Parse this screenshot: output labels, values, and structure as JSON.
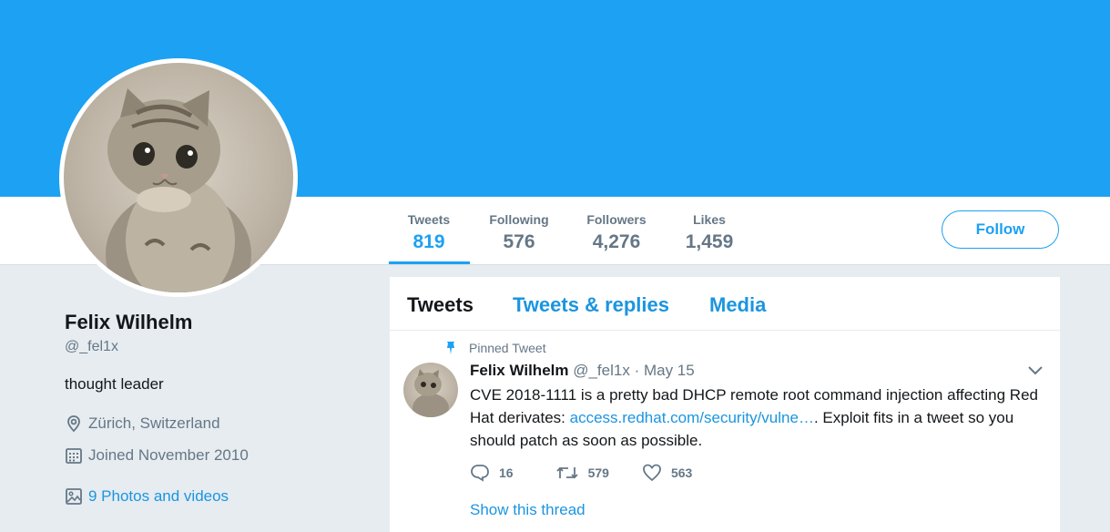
{
  "colors": {
    "banner": "#1da1f2",
    "accent": "#1da1f2",
    "link": "#1b95e0",
    "muted": "#657786"
  },
  "stats": [
    {
      "label": "Tweets",
      "value": "819"
    },
    {
      "label": "Following",
      "value": "576"
    },
    {
      "label": "Followers",
      "value": "4,276"
    },
    {
      "label": "Likes",
      "value": "1,459"
    }
  ],
  "follow_button": "Follow",
  "profile": {
    "name": "Felix Wilhelm",
    "handle": "@_fel1x",
    "bio": "thought leader",
    "location": "Zürich, Switzerland",
    "joined": "Joined November 2010",
    "photos": "9 Photos and videos"
  },
  "tabs": [
    "Tweets",
    "Tweets & replies",
    "Media"
  ],
  "tweet": {
    "pinned_label": "Pinned Tweet",
    "author": "Felix Wilhelm",
    "meta": "@_fel1x · May 15",
    "text_before": "CVE 2018-1111 is a pretty bad DHCP remote root command injection affecting Red Hat derivates: ",
    "link": "access.redhat.com/security/vulne…",
    "text_after": ". Exploit fits in a tweet so you should patch as soon as possible.",
    "replies": "16",
    "retweets": "579",
    "likes": "563",
    "show_thread": "Show this thread"
  },
  "icons": [
    "location-pin-icon",
    "calendar-icon",
    "photo-icon",
    "pin-icon",
    "chevron-down-icon",
    "reply-icon",
    "retweet-icon",
    "heart-icon"
  ]
}
